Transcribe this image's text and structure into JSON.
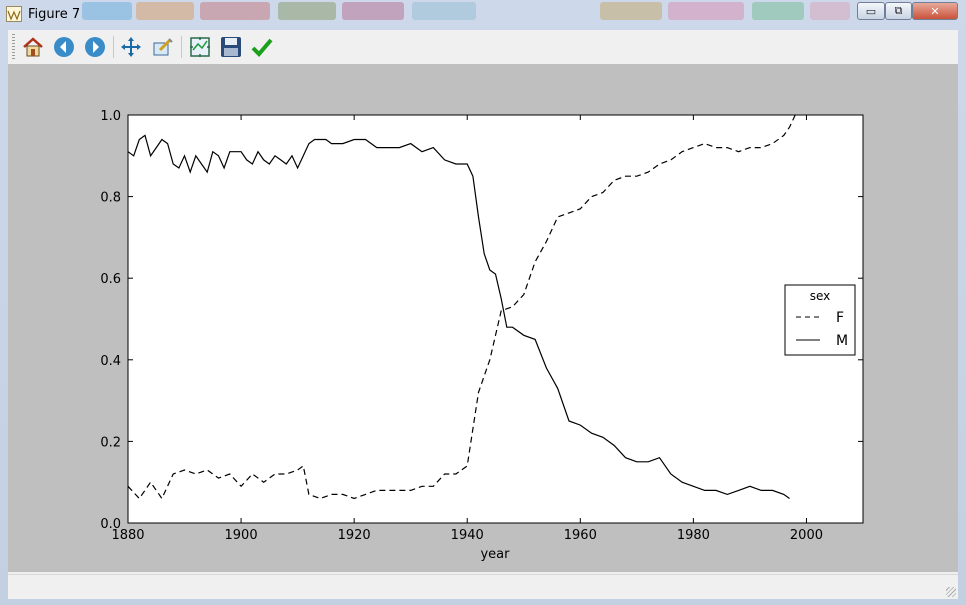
{
  "window": {
    "title": "Figure 7",
    "buttons": {
      "minimize": "▭",
      "maximize": "⧉",
      "close": "✕"
    }
  },
  "toolbar": {
    "items": [
      {
        "name": "home",
        "icon": "home-icon"
      },
      {
        "name": "back",
        "icon": "back-arrow-icon"
      },
      {
        "name": "forward",
        "icon": "forward-arrow-icon"
      },
      {
        "name": "pan",
        "icon": "pan-arrows-icon"
      },
      {
        "name": "zoom",
        "icon": "zoom-rect-icon"
      },
      {
        "name": "subplots",
        "icon": "subplots-icon"
      },
      {
        "name": "save",
        "icon": "floppy-save-icon"
      },
      {
        "name": "edit",
        "icon": "checkmark-icon"
      }
    ]
  },
  "chart_data": {
    "type": "line",
    "xlabel": "year",
    "ylabel": "",
    "xlim": [
      1880,
      2010
    ],
    "ylim": [
      0.0,
      1.0
    ],
    "xticks": [
      "1880",
      "1900",
      "1920",
      "1940",
      "1960",
      "1980",
      "2000"
    ],
    "yticks": [
      "0.0",
      "0.2",
      "0.4",
      "0.6",
      "0.8",
      "1.0"
    ],
    "grid": false,
    "legend": {
      "title": "sex",
      "placement": "center-right"
    },
    "series": [
      {
        "name": "F",
        "style": "dashed",
        "color": "#000000",
        "x": [
          1880,
          1882,
          1884,
          1886,
          1888,
          1890,
          1892,
          1894,
          1896,
          1898,
          1900,
          1902,
          1904,
          1906,
          1908,
          1910,
          1911,
          1912,
          1914,
          1916,
          1918,
          1920,
          1922,
          1924,
          1926,
          1928,
          1930,
          1932,
          1934,
          1936,
          1938,
          1940,
          1942,
          1944,
          1946,
          1948,
          1950,
          1952,
          1954,
          1956,
          1958,
          1960,
          1962,
          1964,
          1966,
          1968,
          1970,
          1972,
          1974,
          1976,
          1978,
          1980,
          1982,
          1984,
          1986,
          1988,
          1990,
          1992,
          1994,
          1996,
          1997,
          1998
        ],
        "y": [
          0.09,
          0.06,
          0.1,
          0.06,
          0.12,
          0.13,
          0.12,
          0.13,
          0.11,
          0.12,
          0.09,
          0.12,
          0.1,
          0.12,
          0.12,
          0.13,
          0.14,
          0.07,
          0.06,
          0.07,
          0.07,
          0.06,
          0.07,
          0.08,
          0.08,
          0.08,
          0.08,
          0.09,
          0.09,
          0.12,
          0.12,
          0.14,
          0.32,
          0.4,
          0.52,
          0.53,
          0.56,
          0.64,
          0.69,
          0.75,
          0.76,
          0.77,
          0.8,
          0.81,
          0.84,
          0.85,
          0.85,
          0.86,
          0.88,
          0.89,
          0.91,
          0.92,
          0.93,
          0.92,
          0.92,
          0.91,
          0.92,
          0.92,
          0.93,
          0.95,
          0.97,
          1.0
        ]
      },
      {
        "name": "M",
        "style": "solid",
        "color": "#000000",
        "x": [
          1880,
          1881,
          1882,
          1883,
          1884,
          1885,
          1886,
          1887,
          1888,
          1889,
          1890,
          1891,
          1892,
          1893,
          1894,
          1895,
          1896,
          1897,
          1898,
          1899,
          1900,
          1901,
          1902,
          1903,
          1904,
          1905,
          1906,
          1907,
          1908,
          1909,
          1910,
          1911,
          1912,
          1913,
          1914,
          1915,
          1916,
          1918,
          1920,
          1922,
          1924,
          1926,
          1928,
          1930,
          1932,
          1934,
          1936,
          1938,
          1940,
          1941,
          1942,
          1943,
          1944,
          1945,
          1946,
          1947,
          1948,
          1950,
          1952,
          1954,
          1956,
          1958,
          1960,
          1962,
          1964,
          1966,
          1968,
          1970,
          1972,
          1974,
          1976,
          1978,
          1980,
          1982,
          1984,
          1986,
          1988,
          1990,
          1992,
          1994,
          1996,
          1997
        ],
        "y": [
          0.91,
          0.9,
          0.94,
          0.95,
          0.9,
          0.92,
          0.94,
          0.93,
          0.88,
          0.87,
          0.9,
          0.86,
          0.9,
          0.88,
          0.86,
          0.91,
          0.9,
          0.87,
          0.91,
          0.91,
          0.91,
          0.89,
          0.88,
          0.91,
          0.89,
          0.88,
          0.9,
          0.89,
          0.88,
          0.9,
          0.87,
          0.9,
          0.93,
          0.94,
          0.94,
          0.94,
          0.93,
          0.93,
          0.94,
          0.94,
          0.92,
          0.92,
          0.92,
          0.93,
          0.91,
          0.92,
          0.89,
          0.88,
          0.88,
          0.85,
          0.75,
          0.66,
          0.62,
          0.61,
          0.55,
          0.48,
          0.48,
          0.46,
          0.45,
          0.38,
          0.33,
          0.25,
          0.24,
          0.22,
          0.21,
          0.19,
          0.16,
          0.15,
          0.15,
          0.16,
          0.12,
          0.1,
          0.09,
          0.08,
          0.08,
          0.07,
          0.08,
          0.09,
          0.08,
          0.08,
          0.07,
          0.06
        ]
      }
    ]
  }
}
